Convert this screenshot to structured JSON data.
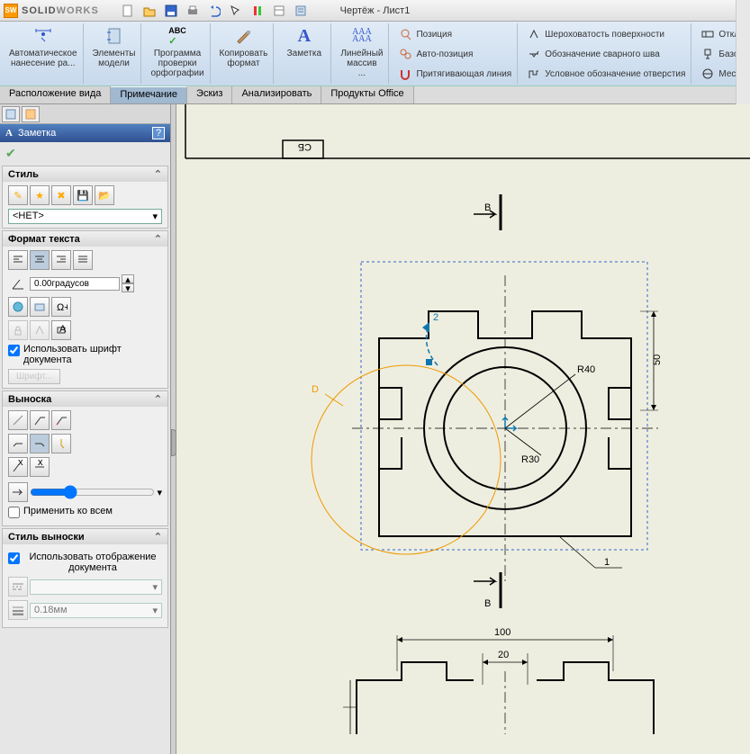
{
  "app": {
    "name_bold": "SOLID",
    "name_light": "WORKS"
  },
  "document_title": "Чертёж - Лист1",
  "ribbon": {
    "auto_dim": "Автоматическое\nнанесение ра...",
    "model_items": "Элементы\nмодели",
    "spell": "Программа\nпроверки\nорфографии",
    "copy_fmt": "Копировать\nформат",
    "note": "Заметка",
    "linear_pat": "Линейный\nмассив\n...",
    "position": "Позиция",
    "auto_position": "Авто-позиция",
    "magnet_line": "Притягивающая линия",
    "surface_finish": "Шероховатость поверхности",
    "weld_symbol": "Обозначение сварного шва",
    "hole_callout": "Условное обозначение отверстия",
    "deviation": "Откл",
    "datum": "Базо",
    "gtol": "Мест"
  },
  "tabs": {
    "view_layout": "Расположение вида",
    "annotation": "Примечание",
    "sketch": "Эскиз",
    "evaluate": "Анализировать",
    "office": "Продукты Office"
  },
  "pm": {
    "title": "Заметка",
    "style": {
      "header": "Стиль",
      "none": "<НЕТ>"
    },
    "text_format": {
      "header": "Формат текста",
      "angle": "0.00градусов",
      "use_doc_font": "Использовать шрифт документа",
      "font_btn": "Шрифт..."
    },
    "leader": {
      "header": "Выноска",
      "apply_all": "Применить ко всем"
    },
    "leader_style": {
      "header": "Стиль выноски",
      "use_doc_display": "Использовать отображение документа",
      "thickness": "0.18мм"
    }
  },
  "drawing": {
    "section_label_top": "В",
    "section_label_bottom": "В",
    "detail_label": "D",
    "balloon": "2",
    "balloon_item": "1",
    "r40": "R40",
    "r30": "R30",
    "dim50": "50",
    "dim100": "100",
    "dim20": "20",
    "title_rot": "СБ"
  }
}
